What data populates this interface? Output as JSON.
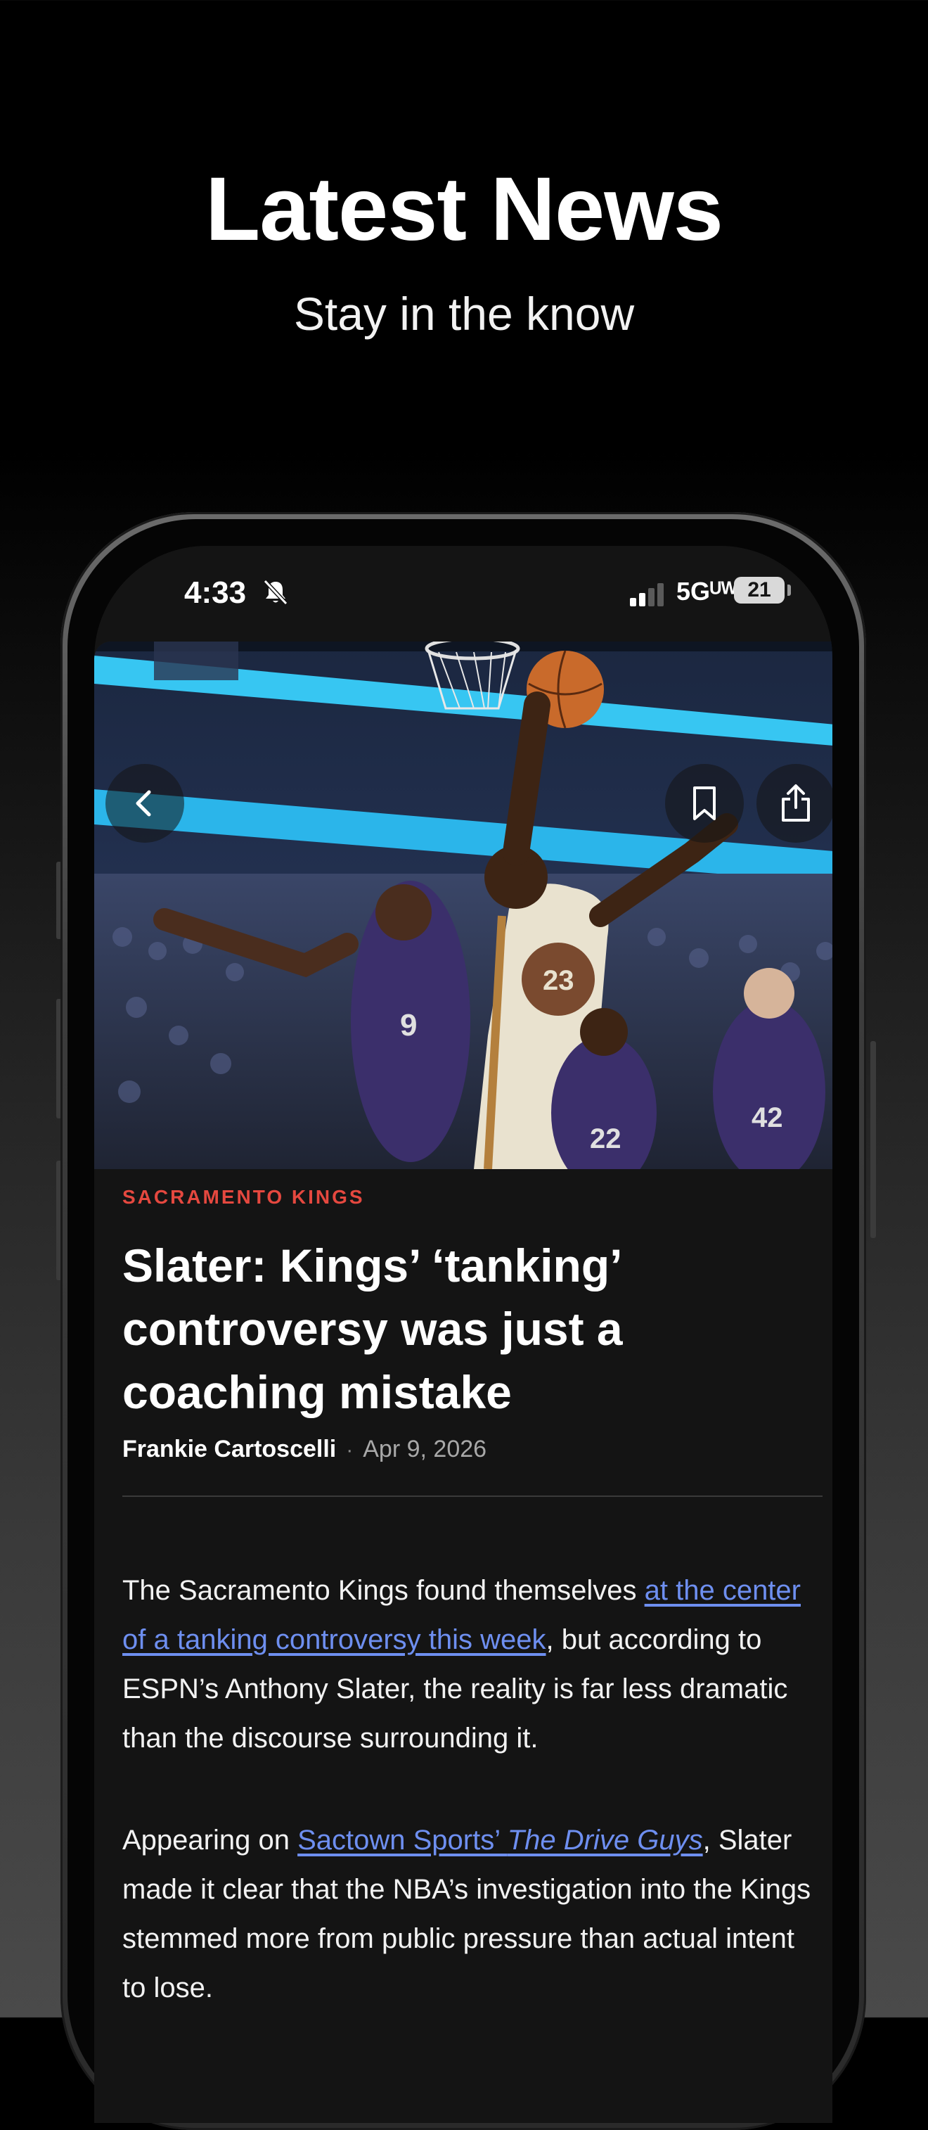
{
  "promo": {
    "title": "Latest News",
    "subtitle": "Stay in the know"
  },
  "status_bar": {
    "time": "4:33",
    "network": "5Gᵁᵂ",
    "battery": "21"
  },
  "article": {
    "category": "SACRAMENTO KINGS",
    "headline": "Slater: Kings’ ‘tanking’ controversy was just a coaching mistake",
    "author": "Frankie Cartoscelli",
    "separator": "·",
    "date": "Apr 9, 2026",
    "paragraph1": {
      "before": "The Sacramento Kings found themselves ",
      "link": "at the center of a tanking controversy this week",
      "after": ", but according to ESPN’s Anthony Slater, the reality is far less dramatic than the discourse surrounding it."
    },
    "paragraph2": {
      "before": "Appearing on ",
      "link_plain": "Sactown Sports’ ",
      "link_italic": "The Drive Guys",
      "after": ", Slater made it clear that the NBA’s investigation into the Kings stemmed more from public pressure than actual intent to lose."
    }
  },
  "icons": {
    "back": "chevron-left-icon",
    "bookmark": "bookmark-icon",
    "share": "share-icon",
    "mute": "bell-off-icon",
    "signal": "signal-icon"
  },
  "colors": {
    "category": "#e5483f",
    "link": "#6e8ff0",
    "screen_bg": "#141414"
  }
}
